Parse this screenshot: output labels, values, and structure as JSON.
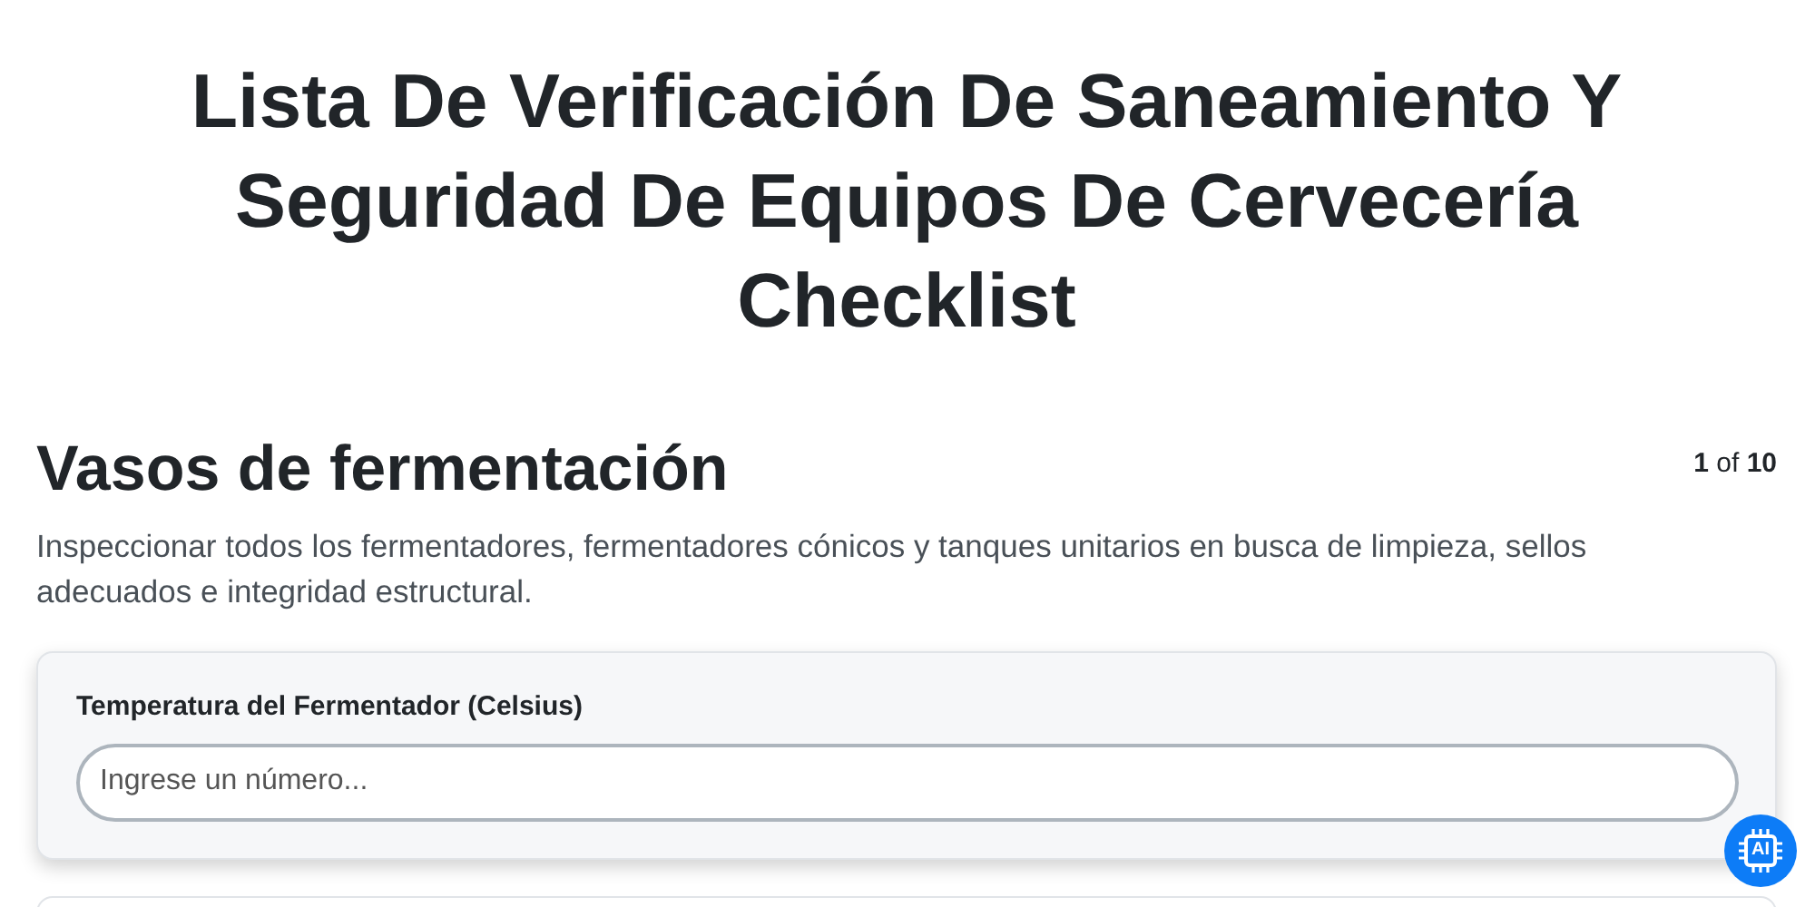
{
  "title": "Lista De Verificación De Saneamiento Y Seguridad De Equipos De Cervecería Checklist",
  "section": {
    "heading": "Vasos de fermentación",
    "progress": "**1** of **10**",
    "description": "Inspeccionar todos los fermentadores, fermentadores cónicos y tanques unitarios en busca de limpieza, sellos adecuados e integridad estructural."
  },
  "questions": [
    {
      "label": "Temperatura del Fermentador (Celsius)",
      "placeholder": "Ingrese un número..."
    }
  ],
  "ai_button": {
    "label": "AI"
  }
}
